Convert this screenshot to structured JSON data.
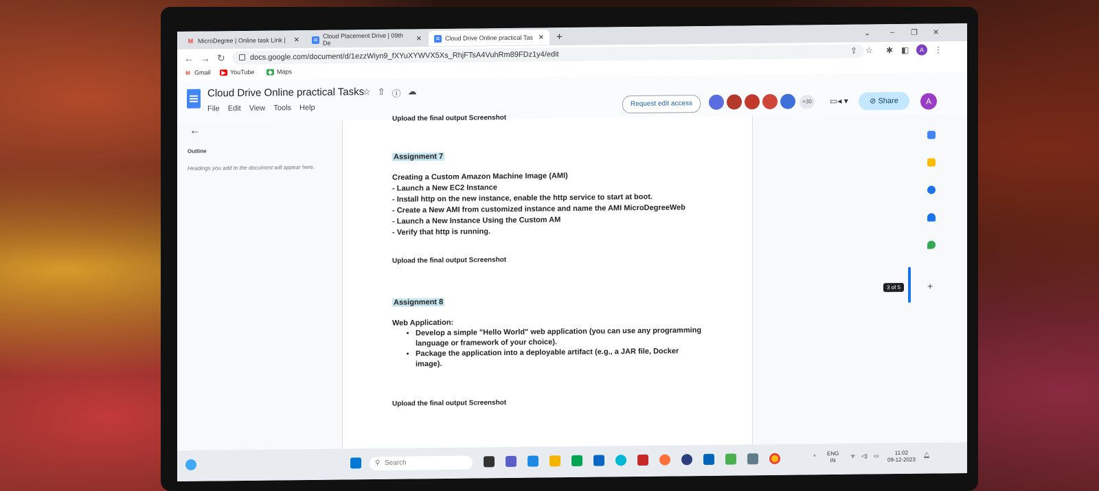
{
  "tabs": [
    {
      "label": "MicroDegree | Online task Link |",
      "favicon": "gmail-icon",
      "active": false
    },
    {
      "label": "Cloud Placement Drive | 09th De",
      "favicon": "docs-icon",
      "active": false
    },
    {
      "label": "Cloud Drive Online practical Tas",
      "favicon": "docs-icon",
      "active": true
    }
  ],
  "url": "docs.google.com/document/d/1ezzWiyn9_fXYuXYWVX5Xs_RhjFTsA4VuhRm89FDz1y4/edit",
  "bookmarks": [
    {
      "label": "Gmail",
      "color": "#ea4335"
    },
    {
      "label": "YouTube",
      "color": "#ff0000"
    },
    {
      "label": "Maps",
      "color": "#34a853"
    }
  ],
  "doc": {
    "title": "Cloud Drive Online practical  Tasks",
    "menu": [
      "File",
      "Edit",
      "View",
      "Tools",
      "Help"
    ],
    "request_access": "Request edit access",
    "more_collaborators": "+30",
    "share": "Share",
    "avatar_letter": "A"
  },
  "outline": {
    "title": "Outline",
    "hint": "Headings you add to the document will appear here."
  },
  "content": {
    "cutoff_text": "Upload the final output Screenshot",
    "a7_heading": "Assignment 7",
    "a7_lines": [
      "Creating a Custom Amazon Machine Image (AMI)",
      "- Launch a New EC2 Instance",
      "- Install http on the new instance, enable the http service to start at boot.",
      "- Create a New AMI from customized instance and name the AMI MicroDegreeWeb",
      "- Launch a New Instance Using the Custom AM",
      "- Verify that http is running."
    ],
    "a7_upload": "Upload the final output Screenshot",
    "a8_heading": "Assignment 8",
    "a8_intro": "Web Application:",
    "a8_bullets": [
      "Develop a simple \"Hello World\" web application (you can use any programming language or framework of your choice).",
      "Package the application into a deployable artifact (e.g., a JAR file, Docker image)."
    ],
    "a8_upload": "Upload the final output Screenshot"
  },
  "page_indicator": "3 of 5",
  "taskbar": {
    "search_placeholder": "Search",
    "lang": "ENG",
    "region": "IN",
    "time": "11:02",
    "date": "09-12-2023"
  }
}
